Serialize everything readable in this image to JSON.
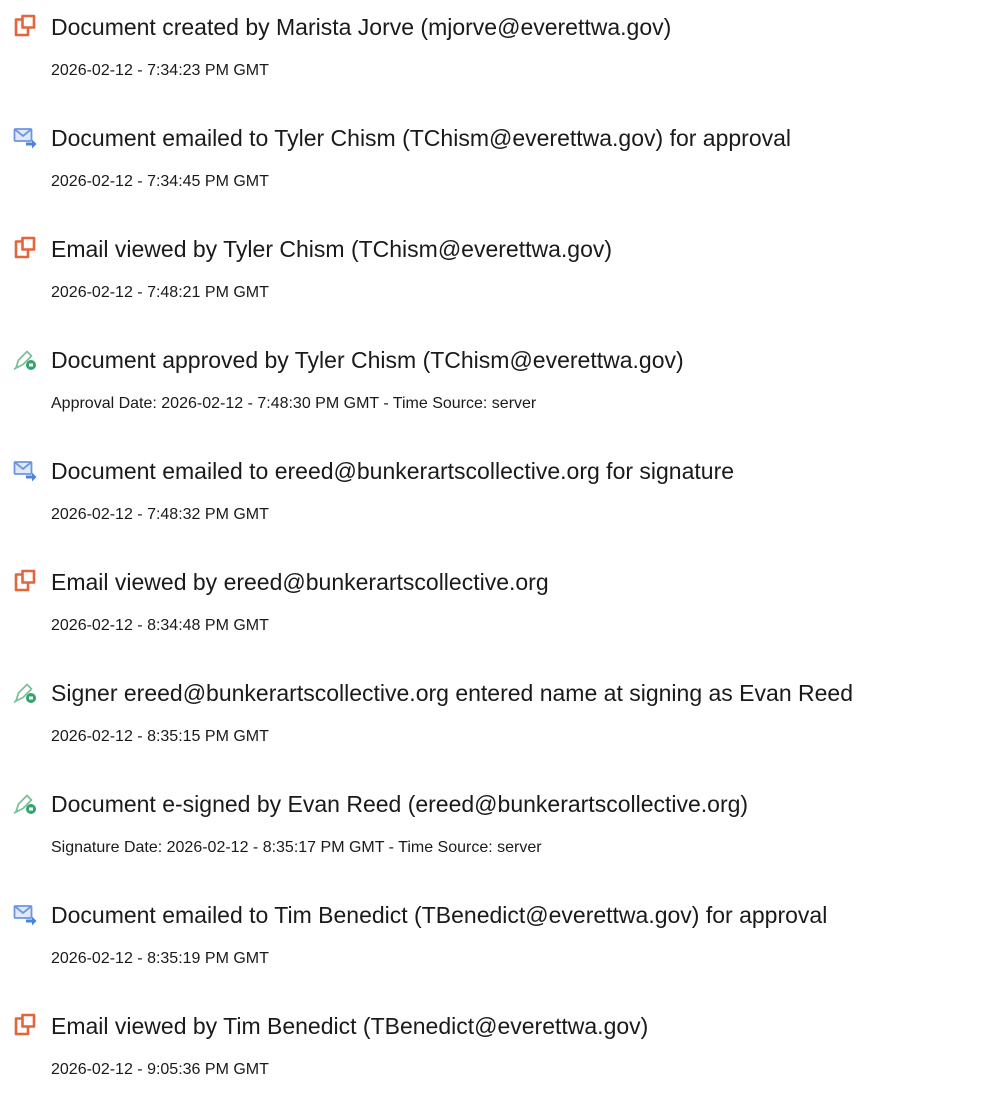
{
  "colors": {
    "view_icon": "#e4643b",
    "email_icon": "#6c95e0",
    "sign_icon": "#56b98f",
    "text": "#1a1a1a",
    "background": "#ffffff"
  },
  "events": [
    {
      "icon": "document-view-icon",
      "title": "Document created by Marista Jorve (mjorve@everettwa.gov)",
      "detail": "2026-02-12 - 7:34:23 PM GMT"
    },
    {
      "icon": "email-sent-icon",
      "title": "Document emailed to Tyler Chism (TChism@everettwa.gov) for approval",
      "detail": "2026-02-12 - 7:34:45 PM GMT"
    },
    {
      "icon": "document-view-icon",
      "title": "Email viewed by Tyler Chism (TChism@everettwa.gov)",
      "detail": "2026-02-12 - 7:48:21 PM GMT"
    },
    {
      "icon": "pen-sign-icon",
      "title": "Document approved by Tyler Chism (TChism@everettwa.gov)",
      "detail": "Approval Date: 2026-02-12 - 7:48:30 PM GMT - Time Source: server"
    },
    {
      "icon": "email-sent-icon",
      "title": "Document emailed to ereed@bunkerartscollective.org for signature",
      "detail": "2026-02-12 - 7:48:32 PM GMT"
    },
    {
      "icon": "document-view-icon",
      "title": "Email viewed by ereed@bunkerartscollective.org",
      "detail": "2026-02-12 - 8:34:48 PM GMT"
    },
    {
      "icon": "pen-sign-icon",
      "title": "Signer ereed@bunkerartscollective.org entered name at signing as Evan Reed",
      "detail": "2026-02-12 - 8:35:15 PM GMT"
    },
    {
      "icon": "pen-sign-icon",
      "title": "Document e-signed by Evan Reed (ereed@bunkerartscollective.org)",
      "detail": "Signature Date: 2026-02-12 - 8:35:17 PM GMT - Time Source: server"
    },
    {
      "icon": "email-sent-icon",
      "title": "Document emailed to Tim Benedict (TBenedict@everettwa.gov) for approval",
      "detail": "2026-02-12 - 8:35:19 PM GMT"
    },
    {
      "icon": "document-view-icon",
      "title": "Email viewed by Tim Benedict (TBenedict@everettwa.gov)",
      "detail": "2026-02-12 - 9:05:36 PM GMT"
    }
  ]
}
